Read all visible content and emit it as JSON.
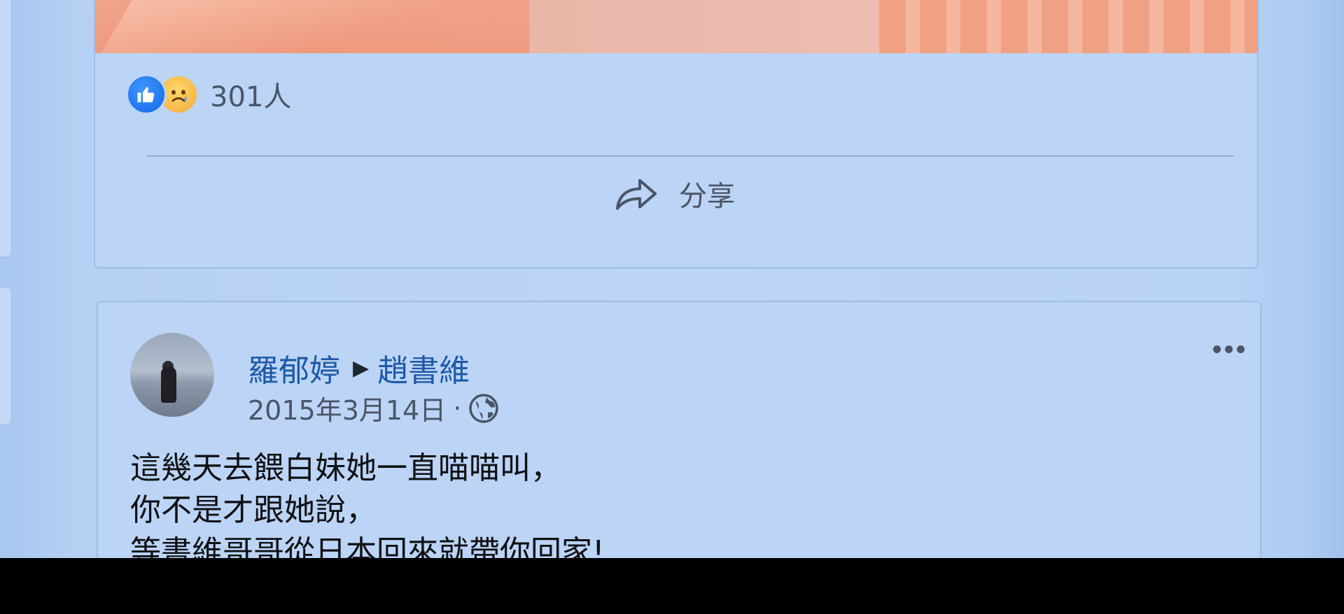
{
  "top_post": {
    "reaction_count": "301人",
    "share_label": "分享",
    "icons": [
      "like-icon",
      "sad-icon",
      "share-icon"
    ]
  },
  "post": {
    "author": "羅郁婷",
    "separator_icon": "triangle-right-icon",
    "target": "趙書維",
    "date": "2015年3月14日",
    "dot": "·",
    "privacy_icon": "globe-icon",
    "more_icon": "more-dots-icon",
    "body_lines": [
      "這幾天去餵白妹她一直喵喵叫，",
      "你不是才跟她說，",
      "等書維哥哥從日本回來就帶你回家!"
    ]
  },
  "colors": {
    "background": "#bcd4f5",
    "link_blue": "#1e59a8",
    "meta_gray": "#4a5568",
    "like_blue": "#1466e6"
  }
}
